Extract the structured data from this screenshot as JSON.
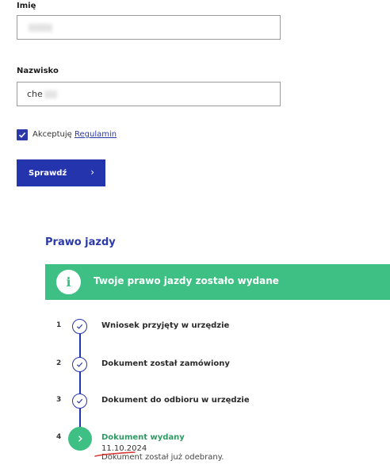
{
  "form": {
    "first_name_label": "Imię",
    "first_name_value": "",
    "last_name_label": "Nazwisko",
    "last_name_value": "che",
    "accept_prefix": "Akceptuję ",
    "accept_link": "Regulamin",
    "submit_label": "Sprawdź",
    "submit_chevron": "›"
  },
  "status": {
    "section_title": "Prawo jazdy",
    "banner_icon_glyph": "i",
    "banner_text": "Twoje prawo jazdy zostało wydane",
    "steps": [
      {
        "number": "1",
        "label": "Wniosek przyjęty w urzędzie",
        "icon": "check-icon"
      },
      {
        "number": "2",
        "label": "Dokument został zamówiony",
        "icon": "check-icon"
      },
      {
        "number": "3",
        "label": "Dokument do odbioru w urzędzie",
        "icon": "check-icon"
      }
    ],
    "final_step": {
      "number": "4",
      "label": "Dokument wydany",
      "date": "11.10.2024",
      "description": "Dokument został już odebrany.",
      "icon": "chevron-right-icon"
    }
  },
  "colors": {
    "brand_blue": "#2434ad",
    "success_green": "#3ebf83",
    "annotation_red": "#d63a3a"
  }
}
